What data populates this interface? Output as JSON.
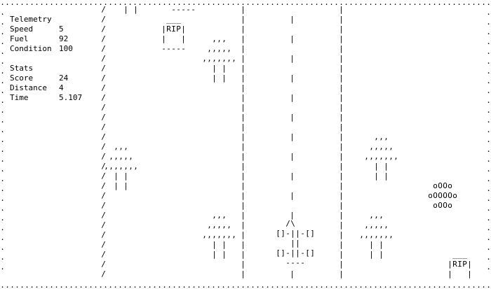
{
  "hud": {
    "telemetry_title": "Telemetry",
    "speed_label": "Speed",
    "speed_value": "5",
    "fuel_label": "Fuel",
    "fuel_value": "92",
    "condition_label": "Condition",
    "condition_value": "100",
    "stats_title": "Stats",
    "score_label": "Score",
    "score_value": "24",
    "distance_label": "Distance",
    "distance_value": "4",
    "time_label": "Time",
    "time_value": "5.107"
  },
  "glyphs": {
    "border_dot": ".",
    "road_edge_left": "/",
    "road_divider": "|",
    "lane_stripe": "|"
  },
  "sprites": {
    "tree": [
      "  ,,,  ",
      " ,,,,, ",
      ",,,,,,,",
      "  | |  ",
      "  | |  "
    ],
    "tree_trunk_top": [
      "| |"
    ],
    "gravestone": [
      " ___ ",
      "|RIP|",
      "|   |",
      "-----"
    ],
    "gravestone_partial": [
      "-----"
    ],
    "gravestone_bottom": [
      " ___ ",
      "|RIP|",
      "|   |"
    ],
    "player_car": [
      "  /\\  ",
      "[]-||-[]",
      "   ||   ",
      "[]-||-[]",
      "  ----  "
    ],
    "bush": [
      " oOOo ",
      "oOOOOo",
      " oOOo "
    ]
  },
  "colors": {
    "background": "#ffffff",
    "ink": "#000000"
  }
}
